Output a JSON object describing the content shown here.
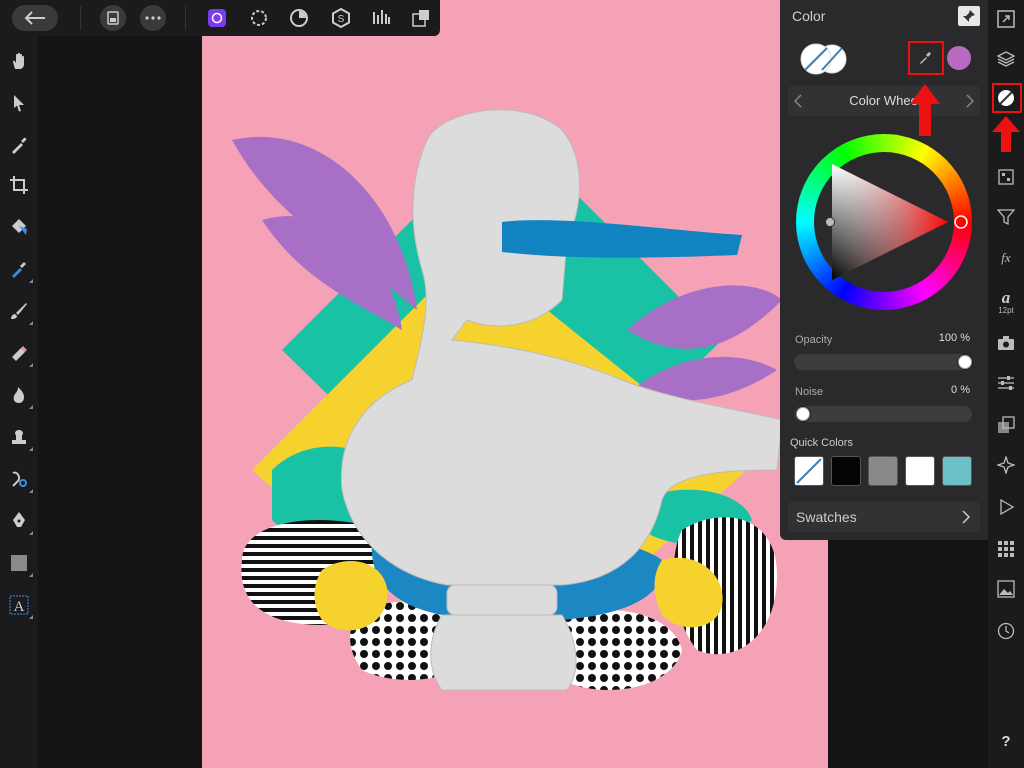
{
  "panel": {
    "title": "Color",
    "mode_label": "Color Wheel",
    "opacity_label": "Opacity",
    "opacity_value": "100 %",
    "opacity_fraction": 1.0,
    "noise_label": "Noise",
    "noise_value": "0 %",
    "noise_fraction": 0.0,
    "quick_colors_label": "Quick Colors",
    "quick_colors": [
      "none",
      "#050505",
      "#888888",
      "#ffffff",
      "#6cc1c9"
    ],
    "swatches_label": "Swatches",
    "selected_color": "#b86ac0"
  },
  "right_bar": {
    "text_tool_label": "12pt",
    "help_label": "?"
  },
  "colors": {
    "accent_purple": "#7b3cf0",
    "artboard_pink": "#f5a1b6",
    "highlight_red": "#e11111"
  }
}
